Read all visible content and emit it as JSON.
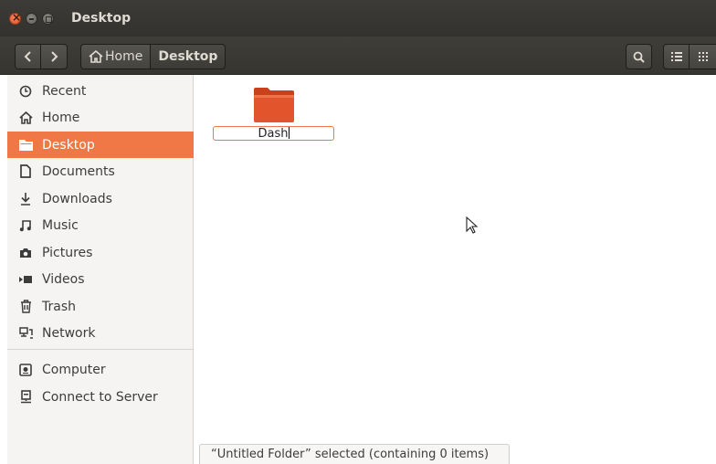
{
  "window": {
    "title": "Desktop"
  },
  "toolbar": {
    "back_icon": "chevron-left-icon",
    "forward_icon": "chevron-right-icon",
    "breadcrumbs": [
      {
        "label": "Home",
        "icon": "home-icon"
      },
      {
        "label": "Desktop"
      }
    ],
    "search_icon": "search-icon",
    "list_view_icon": "list-view-icon",
    "grid_view_icon": "grid-view-icon"
  },
  "sidebar": {
    "items": [
      {
        "label": "Recent",
        "icon": "clock-icon"
      },
      {
        "label": "Home",
        "icon": "home-icon"
      },
      {
        "label": "Desktop",
        "icon": "folder-icon",
        "active": true
      },
      {
        "label": "Documents",
        "icon": "document-icon"
      },
      {
        "label": "Downloads",
        "icon": "download-icon"
      },
      {
        "label": "Music",
        "icon": "music-icon"
      },
      {
        "label": "Pictures",
        "icon": "camera-icon"
      },
      {
        "label": "Videos",
        "icon": "video-icon"
      },
      {
        "label": "Trash",
        "icon": "trash-icon"
      },
      {
        "label": "Network",
        "icon": "network-icon"
      },
      {
        "label": "Computer",
        "icon": "computer-icon"
      },
      {
        "label": "Connect to Server",
        "icon": "server-icon"
      }
    ]
  },
  "content": {
    "folder": {
      "icon": "folder-icon",
      "rename_value": "Dash"
    }
  },
  "status": {
    "text": "“Untitled Folder” selected  (containing 0 items)"
  },
  "colors": {
    "accent": "#f07746",
    "folder": "#e2542c",
    "titlebar": "#3c3b37"
  }
}
